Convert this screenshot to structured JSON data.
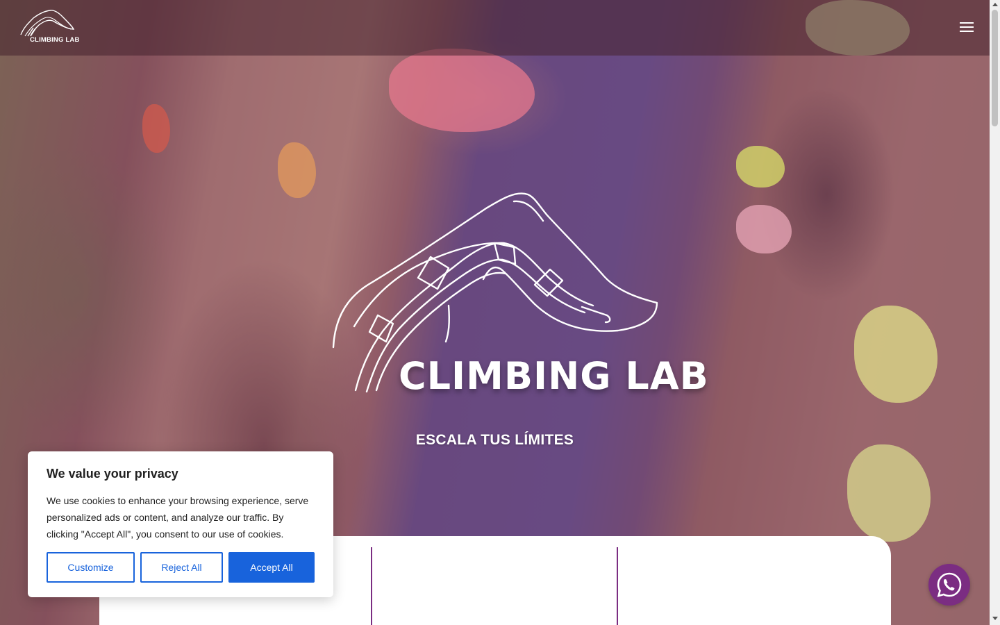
{
  "header": {
    "logo_text": "CLIMBING LAB",
    "menu_icon": "hamburger-icon"
  },
  "hero": {
    "brand": "CLIMBING LAB",
    "tagline": "ESCALA TUS LÍMITES"
  },
  "cookie_banner": {
    "title": "We value your privacy",
    "body": "We use cookies to enhance your browsing experience, serve personalized ads or content, and analyze our traffic. By clicking \"Accept All\", you consent to our use of cookies.",
    "customize_label": "Customize",
    "reject_label": "Reject All",
    "accept_label": "Accept All"
  },
  "whatsapp": {
    "icon": "whatsapp-icon"
  },
  "colors": {
    "accent_purple": "#7b2d82",
    "cookie_blue": "#1863dc",
    "hero_overlay": "#7d2d50"
  }
}
